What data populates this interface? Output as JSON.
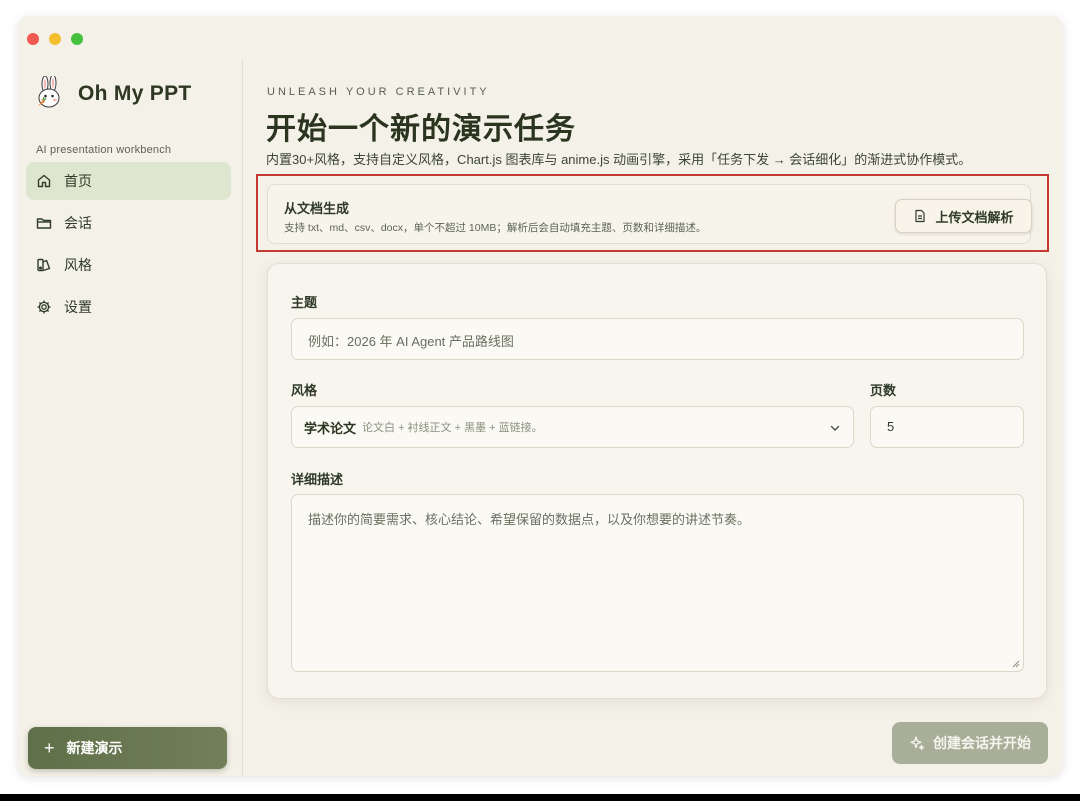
{
  "app": {
    "name": "Oh My PPT",
    "tagline": "AI presentation workbench"
  },
  "sidebar": {
    "items": [
      {
        "label": "首页",
        "icon": "home-icon",
        "active": true
      },
      {
        "label": "会话",
        "icon": "folder-icon",
        "active": false
      },
      {
        "label": "风格",
        "icon": "palette-icon",
        "active": false
      },
      {
        "label": "设置",
        "icon": "gear-icon",
        "active": false
      }
    ],
    "new_button_label": "新建演示"
  },
  "header": {
    "eyebrow": "UNLEASH YOUR CREATIVITY",
    "title": "开始一个新的演示任务",
    "description": "内置30+风格，支持自定义风格，Chart.js 图表库与 anime.js 动画引擎，采用「任务下发 → 会话细化」的渐进式协作模式。"
  },
  "doc_import": {
    "title": "从文档生成",
    "subtitle": "支持 txt、md、csv、docx，单个不超过 10MB；解析后会自动填充主题、页数和详细描述。",
    "button_label": "上传文档解析"
  },
  "form": {
    "topic_label": "主题",
    "topic_placeholder": "例如：2026 年 AI Agent 产品路线图",
    "style_label": "风格",
    "style_value": "学术论文",
    "style_hint": "论文白 + 衬线正文 + 黑墨 + 蓝链接。",
    "pages_label": "页数",
    "pages_value": "5",
    "description_label": "详细描述",
    "description_placeholder": "描述你的简要需求、核心结论、希望保留的数据点，以及你想要的讲述节奏。"
  },
  "create_button_label": "创建会话并开始",
  "colors": {
    "accent": "#5f7049",
    "highlight": "#c23b2e",
    "active_nav": "#dfe6cf",
    "disabled_button": "#a8ae98"
  }
}
